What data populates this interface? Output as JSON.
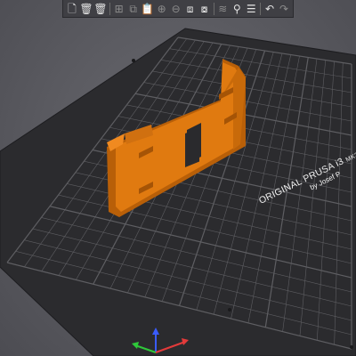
{
  "toolbar": {
    "items": [
      {
        "name": "add-icon",
        "glyph": "🗋",
        "active": true
      },
      {
        "name": "delete-icon",
        "glyph": "🗑",
        "active": true
      },
      {
        "name": "delete-all-icon",
        "glyph": "🗑",
        "active": true
      },
      {
        "name": "arrange-icon",
        "glyph": "⊞",
        "active": false
      },
      {
        "name": "copy-icon",
        "glyph": "⧉",
        "active": false
      },
      {
        "name": "paste-icon",
        "glyph": "📋",
        "active": false
      },
      {
        "name": "add-instance-icon",
        "glyph": "⊕",
        "active": false
      },
      {
        "name": "remove-instance-icon",
        "glyph": "⊖",
        "active": false
      },
      {
        "name": "split-objects-icon",
        "glyph": "⧈",
        "active": true
      },
      {
        "name": "split-parts-icon",
        "glyph": "⧇",
        "active": true
      },
      {
        "name": "variable-layer-height-icon",
        "glyph": "≋",
        "active": false
      },
      {
        "name": "search-icon",
        "glyph": "⚲",
        "active": true
      },
      {
        "name": "layers-editing-icon",
        "glyph": "☰",
        "active": true
      },
      {
        "name": "undo-icon",
        "glyph": "↶",
        "active": true
      },
      {
        "name": "redo-icon",
        "glyph": "↷",
        "active": false
      }
    ]
  },
  "bed": {
    "brand_line1": "ORIGINAL PRUSA i3",
    "brand_model": "MK3",
    "brand_line2": "by Josef P"
  },
  "colors": {
    "bed": "#2b2b2e",
    "grid": "#5e5e62",
    "part": "#e07a10",
    "part_shadow": "#b85f08"
  }
}
